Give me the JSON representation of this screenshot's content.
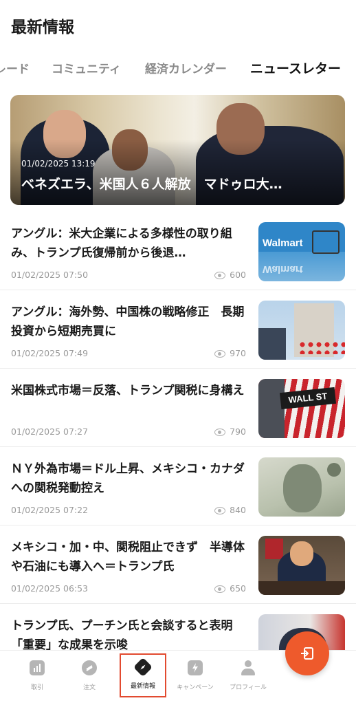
{
  "header": {
    "title": "最新情報"
  },
  "tabs": [
    {
      "label": "レード"
    },
    {
      "label": "コミュニティ"
    },
    {
      "label": "経済カレンダー"
    },
    {
      "label": "ニュースレター",
      "active": true
    }
  ],
  "hero": {
    "time": "01/02/2025 13:19",
    "title": "ベネズエラ、米国人６人解放　マドゥロ大…"
  },
  "news": [
    {
      "title": "アングル：米大企業による多様性の取り組み、トランプ氏復帰前から後退…",
      "date": "01/02/2025 07:50",
      "views": "600",
      "thumb_text": "Walmart"
    },
    {
      "title": "アングル：海外勢、中国株の戦略修正　長期投資から短期売買に",
      "date": "01/02/2025 07:49",
      "views": "970"
    },
    {
      "title": "米国株式市場＝反落、トランプ関税に身構え",
      "date": "01/02/2025 07:27",
      "views": "790",
      "thumb_text": "WALL ST"
    },
    {
      "title": "ＮＹ外為市場＝ドル上昇、メキシコ・カナダへの関税発動控え",
      "date": "01/02/2025 07:22",
      "views": "840"
    },
    {
      "title": "メキシコ・加・中、関税阻止できず　半導体や石油にも導入へ＝トランプ氏",
      "date": "01/02/2025 06:53",
      "views": "650"
    },
    {
      "title": "トランプ氏、プーチン氏と会談すると表明　「重要」な成果を示唆",
      "date": "",
      "views": ""
    }
  ],
  "tabbar": [
    {
      "label": "取引",
      "icon": "chart-icon"
    },
    {
      "label": "注文",
      "icon": "order-icon"
    },
    {
      "label": "最新情報",
      "icon": "news-icon",
      "active": true
    },
    {
      "label": "キャンペーン",
      "icon": "campaign-icon"
    },
    {
      "label": "プロフィール",
      "icon": "profile-icon"
    }
  ],
  "colors": {
    "accent": "#ee5a2c",
    "highlight": "#e24a2f"
  }
}
